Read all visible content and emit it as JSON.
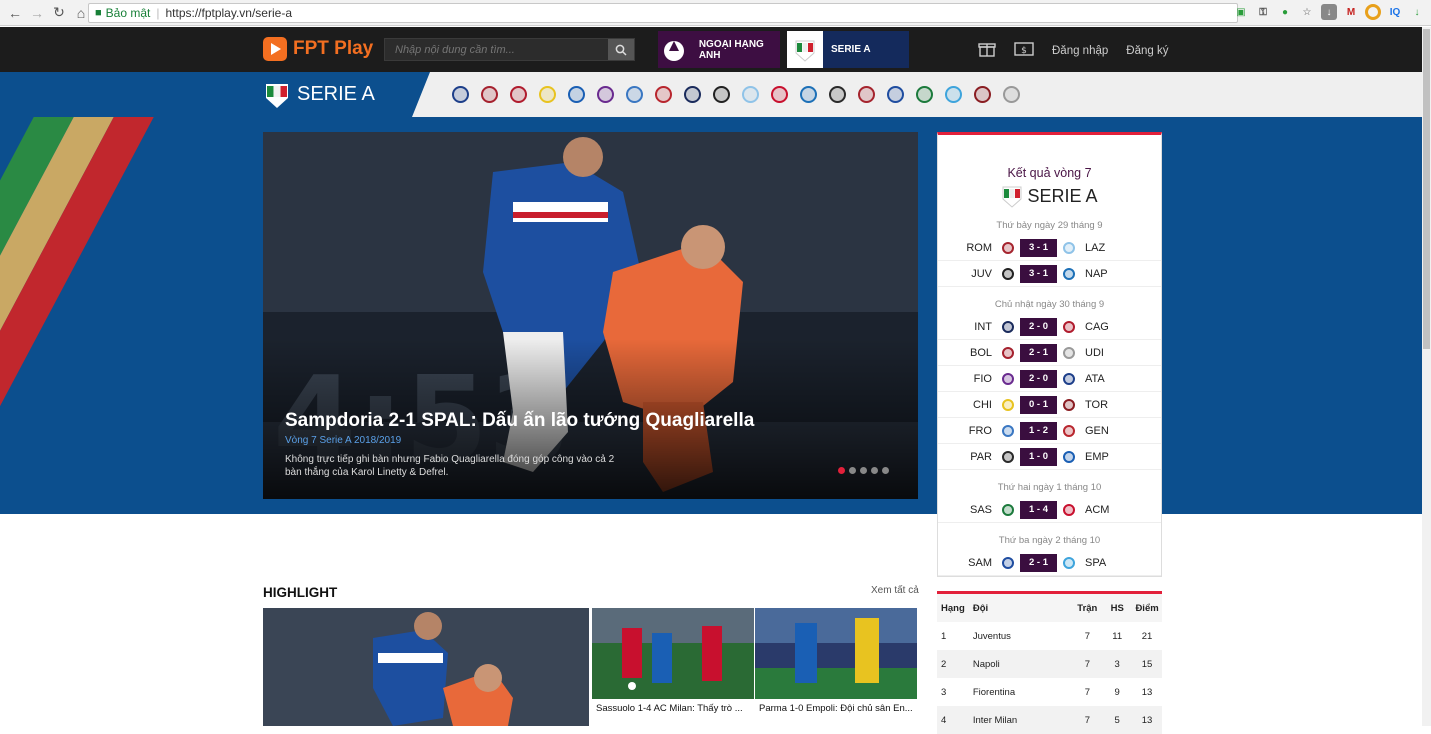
{
  "browser": {
    "secure_label": "Bảo mật",
    "url": "https://fptplay.vn/serie-a"
  },
  "header": {
    "brand": "FPT Play",
    "search_placeholder": "Nhập nội dung cần tìm...",
    "league1": "NGOẠI HẠNG ANH",
    "league2": "SERIE A",
    "login": "Đăng nhập",
    "register": "Đăng ký"
  },
  "serie_nav": {
    "logo_text": "SERIE A",
    "clubs": [
      {
        "name": "atalanta",
        "color": "#1d3f8a"
      },
      {
        "name": "bologna",
        "color": "#a5212e"
      },
      {
        "name": "cagliari",
        "color": "#b01c2e"
      },
      {
        "name": "chievo",
        "color": "#e8c320"
      },
      {
        "name": "empoli",
        "color": "#1a5fb4"
      },
      {
        "name": "fiorentina",
        "color": "#6a2b8f"
      },
      {
        "name": "frosinone",
        "color": "#3a77c2"
      },
      {
        "name": "genoa",
        "color": "#b8262e"
      },
      {
        "name": "inter",
        "color": "#1a2b5c"
      },
      {
        "name": "juventus",
        "color": "#222222"
      },
      {
        "name": "lazio",
        "color": "#8fc3e8"
      },
      {
        "name": "milan",
        "color": "#c8102e"
      },
      {
        "name": "napoli",
        "color": "#1d70b7"
      },
      {
        "name": "parma",
        "color": "#2a2a2a"
      },
      {
        "name": "roma",
        "color": "#a5242e"
      },
      {
        "name": "sampdoria",
        "color": "#1f4da0"
      },
      {
        "name": "sassuolo",
        "color": "#1c7a3c"
      },
      {
        "name": "spal",
        "color": "#3ea4dc"
      },
      {
        "name": "torino",
        "color": "#8a1d22"
      },
      {
        "name": "udinese",
        "color": "#999999"
      }
    ]
  },
  "hero": {
    "title": "Sampdoria 2-1 SPAL: Dấu ấn lão tướng Quagliarella",
    "subtitle": "Vòng 7 Serie A 2018/2019",
    "description": "Không trực tiếp ghi bàn nhưng Fabio Quagliarella đóng góp công vào cả 2 bàn thắng của Karol Linetty & Defrel."
  },
  "results": {
    "title": "Kết quả vòng 7",
    "logo_text": "SERIE A",
    "days": [
      {
        "label": "Thứ bảy ngày 29 tháng 9",
        "matches": [
          {
            "home": "ROM",
            "score": "3 - 1",
            "away": "LAZ",
            "hc": "#a5242e",
            "ac": "#8fc3e8"
          },
          {
            "home": "JUV",
            "score": "3 - 1",
            "away": "NAP",
            "hc": "#222222",
            "ac": "#1d70b7"
          }
        ]
      },
      {
        "label": "Chủ nhật ngày 30 tháng 9",
        "matches": [
          {
            "home": "INT",
            "score": "2 - 0",
            "away": "CAG",
            "hc": "#1a2b5c",
            "ac": "#b01c2e"
          },
          {
            "home": "BOL",
            "score": "2 - 1",
            "away": "UDI",
            "hc": "#a5212e",
            "ac": "#999999"
          },
          {
            "home": "FIO",
            "score": "2 - 0",
            "away": "ATA",
            "hc": "#6a2b8f",
            "ac": "#1d3f8a"
          },
          {
            "home": "CHI",
            "score": "0 - 1",
            "away": "TOR",
            "hc": "#e8c320",
            "ac": "#8a1d22"
          },
          {
            "home": "FRO",
            "score": "1 - 2",
            "away": "GEN",
            "hc": "#3a77c2",
            "ac": "#b8262e"
          },
          {
            "home": "PAR",
            "score": "1 - 0",
            "away": "EMP",
            "hc": "#2a2a2a",
            "ac": "#1a5fb4"
          }
        ]
      },
      {
        "label": "Thứ hai ngày 1 tháng 10",
        "matches": [
          {
            "home": "SAS",
            "score": "1 - 4",
            "away": "ACM",
            "hc": "#1c7a3c",
            "ac": "#c8102e"
          }
        ]
      },
      {
        "label": "Thứ ba ngày 2 tháng 10",
        "matches": [
          {
            "home": "SAM",
            "score": "2 - 1",
            "away": "SPA",
            "hc": "#1f4da0",
            "ac": "#3ea4dc"
          }
        ]
      }
    ]
  },
  "highlight": {
    "title": "HIGHLIGHT",
    "more": "Xem tất cả",
    "cards": [
      {
        "caption": "Sassuolo 1-4 AC Milan: Thấy trò ..."
      },
      {
        "caption": "Parma 1-0 Empoli: Đội chủ sân En..."
      }
    ]
  },
  "standings": {
    "headers": [
      "Hạng",
      "Đội",
      "Trận",
      "HS",
      "Điểm"
    ],
    "rows": [
      {
        "rank": "1",
        "team": "Juventus",
        "played": "7",
        "gd": "11",
        "pts": "21"
      },
      {
        "rank": "2",
        "team": "Napoli",
        "played": "7",
        "gd": "3",
        "pts": "15"
      },
      {
        "rank": "3",
        "team": "Fiorentina",
        "played": "7",
        "gd": "9",
        "pts": "13"
      },
      {
        "rank": "4",
        "team": "Inter Milan",
        "played": "7",
        "gd": "5",
        "pts": "13"
      }
    ]
  },
  "colors": {
    "brand_orange": "#f36f21",
    "serie_blue": "#0c4f8e",
    "score_purple": "#3a0e3f",
    "accent_red": "#e2203a"
  }
}
